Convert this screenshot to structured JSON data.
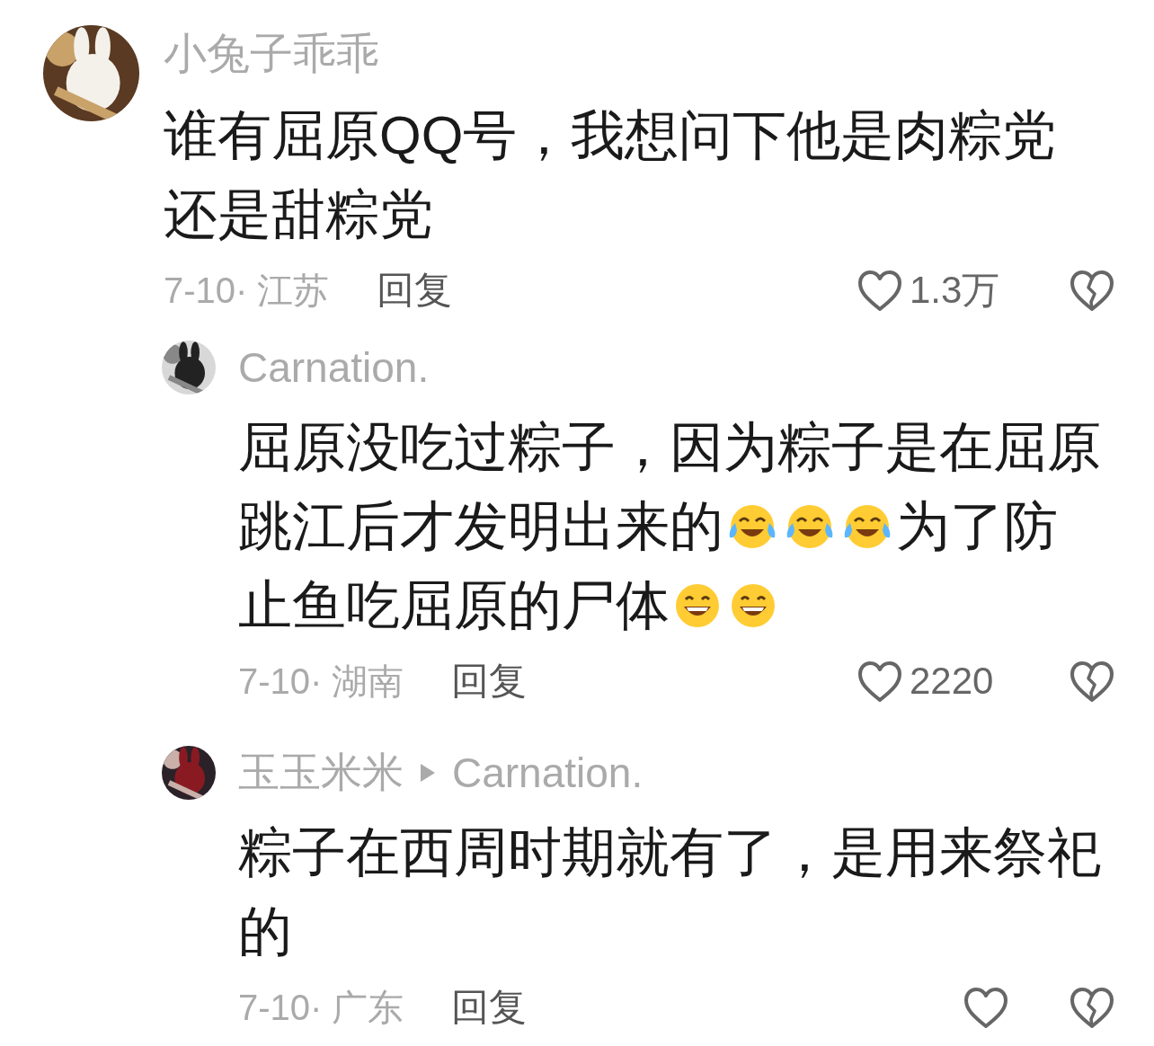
{
  "comments": [
    {
      "author": "小兔子乖乖",
      "lines": [
        [
          {
            "kind": "text",
            "text": "谁有屈原QQ号，我想问下他是肉粽党"
          }
        ],
        [
          {
            "kind": "text",
            "text": "还是甜粽党"
          }
        ]
      ],
      "date_location": "7-10· 江苏",
      "reply_label": "回复",
      "like_count": "1.3万",
      "replies": [
        {
          "author": "Carnation.",
          "lines": [
            [
              {
                "kind": "text",
                "text": "屈原没吃过粽子，因为粽子是在屈原"
              }
            ],
            [
              {
                "kind": "text",
                "text": "跳江后才发明出来的"
              },
              {
                "kind": "tears-of-joy"
              },
              {
                "kind": "tears-of-joy"
              },
              {
                "kind": "tears-of-joy"
              },
              {
                "kind": "text",
                "text": "为了防"
              }
            ],
            [
              {
                "kind": "text",
                "text": "止鱼吃屈原的尸体"
              },
              {
                "kind": "grin"
              },
              {
                "kind": "grin"
              }
            ]
          ],
          "date_location": "7-10· 湖南",
          "reply_label": "回复",
          "like_count": "2220"
        },
        {
          "author": "玉玉米米",
          "reply_to": "Carnation.",
          "lines": [
            [
              {
                "kind": "text",
                "text": "粽子在西周时期就有了，是用来祭祀"
              }
            ],
            [
              {
                "kind": "text",
                "text": "的"
              }
            ]
          ],
          "date_location": "7-10· 广东",
          "reply_label": "回复"
        }
      ]
    }
  ]
}
